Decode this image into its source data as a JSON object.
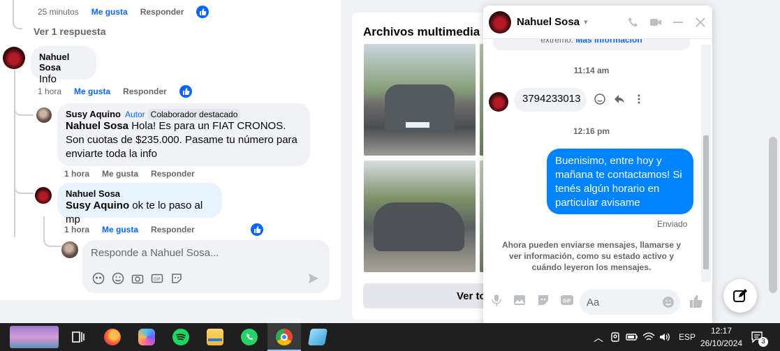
{
  "feed": {
    "top_meta": {
      "time": "25 minutos",
      "like": "Me gusta",
      "reply": "Responder"
    },
    "view_replies": "Ver 1 respuesta",
    "comment1": {
      "author": "Nahuel Sosa",
      "text": "Info",
      "time": "1 hora",
      "like": "Me gusta",
      "reply": "Responder"
    },
    "comment2": {
      "author": "Susy Aquino",
      "tag": "Autor",
      "badge": "Colaborador destacado",
      "mention": "Nahuel Sosa",
      "text": " Hola! Es para un FIAT CRONOS. Son cuotas de $235.000. Pasame tu número para enviarte toda la info",
      "time": "1 hora",
      "like": "Me gusta",
      "reply": "Responder"
    },
    "comment3": {
      "author": "Nahuel Sosa",
      "mention": "Susy Aquino",
      "text": " ok te lo paso al mp",
      "time": "1 hora",
      "like": "Me gusta",
      "reply": "Responder"
    },
    "reply_placeholder": "Responde a Nahuel Sosa..."
  },
  "media": {
    "title": "Archivos multimedia re",
    "button": "Ver to"
  },
  "chat": {
    "name": "Nahuel Sosa",
    "encryption_text": "extremo.",
    "more_info": "Más información",
    "time1": "11:14 am",
    "phone_msg": "3794233013",
    "time2": "12:16 pm",
    "my_msg": "Buenisimo, entre hoy y mañana te contactamos! Si tenés algún horario en particular avisame",
    "status": "Enviado",
    "system_msg": "Ahora pueden enviarse mensajes, llamarse y ver información, como su estado activo y cuándo leyeron los mensajes.",
    "input_placeholder": "Aa"
  },
  "taskbar": {
    "lang": "ESP",
    "time": "12:17",
    "date": "26/10/2024",
    "notifications": "3"
  },
  "colors": {
    "fb_blue": "#0866ff",
    "messenger_blue": "#0084ff",
    "taskbar": "#1f1f1f"
  }
}
